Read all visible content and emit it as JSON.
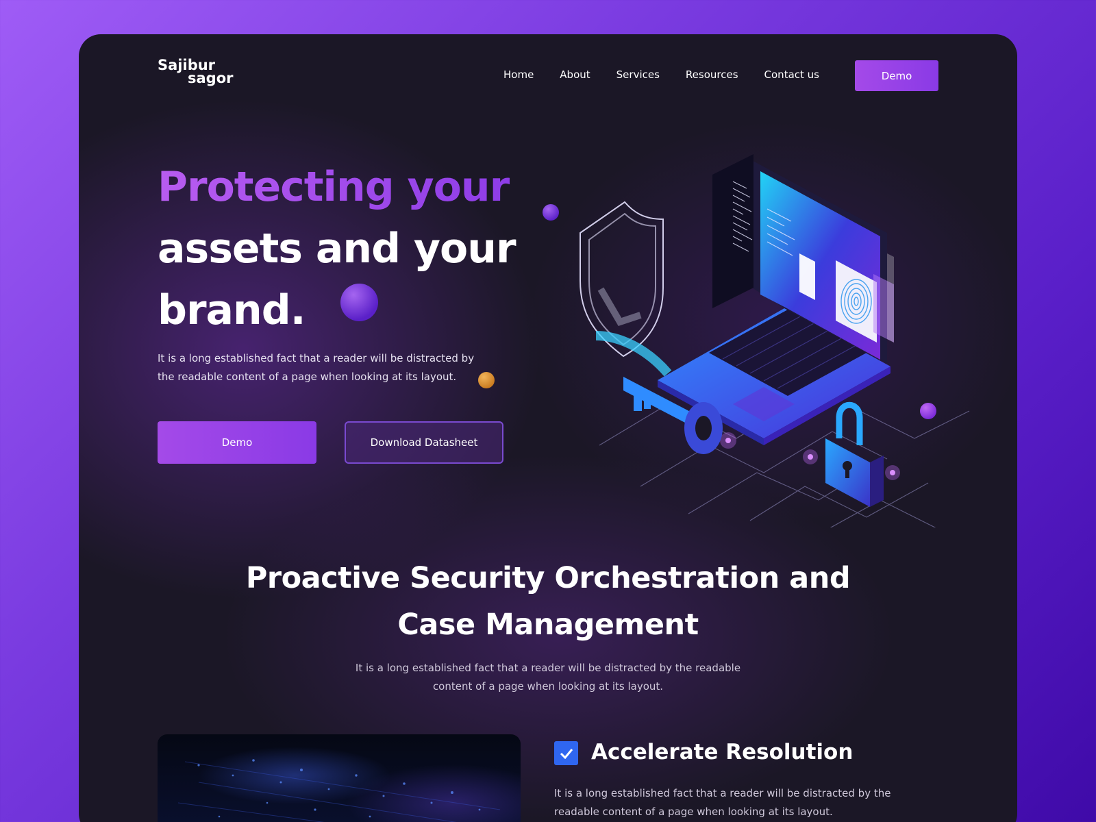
{
  "brand": {
    "logo_line1": "Sajibur",
    "logo_line2": "sagor"
  },
  "nav": {
    "items": [
      "Home",
      "About",
      "Services",
      "Resources",
      "Contact us"
    ],
    "demo_label": "Demo"
  },
  "hero": {
    "title_accent": "Protecting your",
    "title_line2": "assets and your",
    "title_line3": "brand.",
    "description": "It is a long established fact that a reader will be distracted by the readable content of a page when looking at its layout.",
    "demo_button": "Demo",
    "download_button": "Download Datasheet"
  },
  "section": {
    "title": "Proactive Security Orchestration and Case Management",
    "description": "It is a long established fact that a reader will be distracted by the readable content of a page when looking at its layout."
  },
  "feature": {
    "title": "Accelerate Resolution",
    "description": "It is a long established fact that a reader will be distracted by the readable content of a page when looking at its layout.",
    "checked": true
  },
  "colors": {
    "accent_purple": "#a44ae8",
    "card_bg": "#1b1726",
    "check_blue": "#2f66f0",
    "orb_orange": "#e3953a"
  },
  "illustration": {
    "icons": [
      "laptop-icon",
      "shield-check-icon",
      "fingerprint-icon",
      "key-icon",
      "padlock-icon"
    ]
  }
}
